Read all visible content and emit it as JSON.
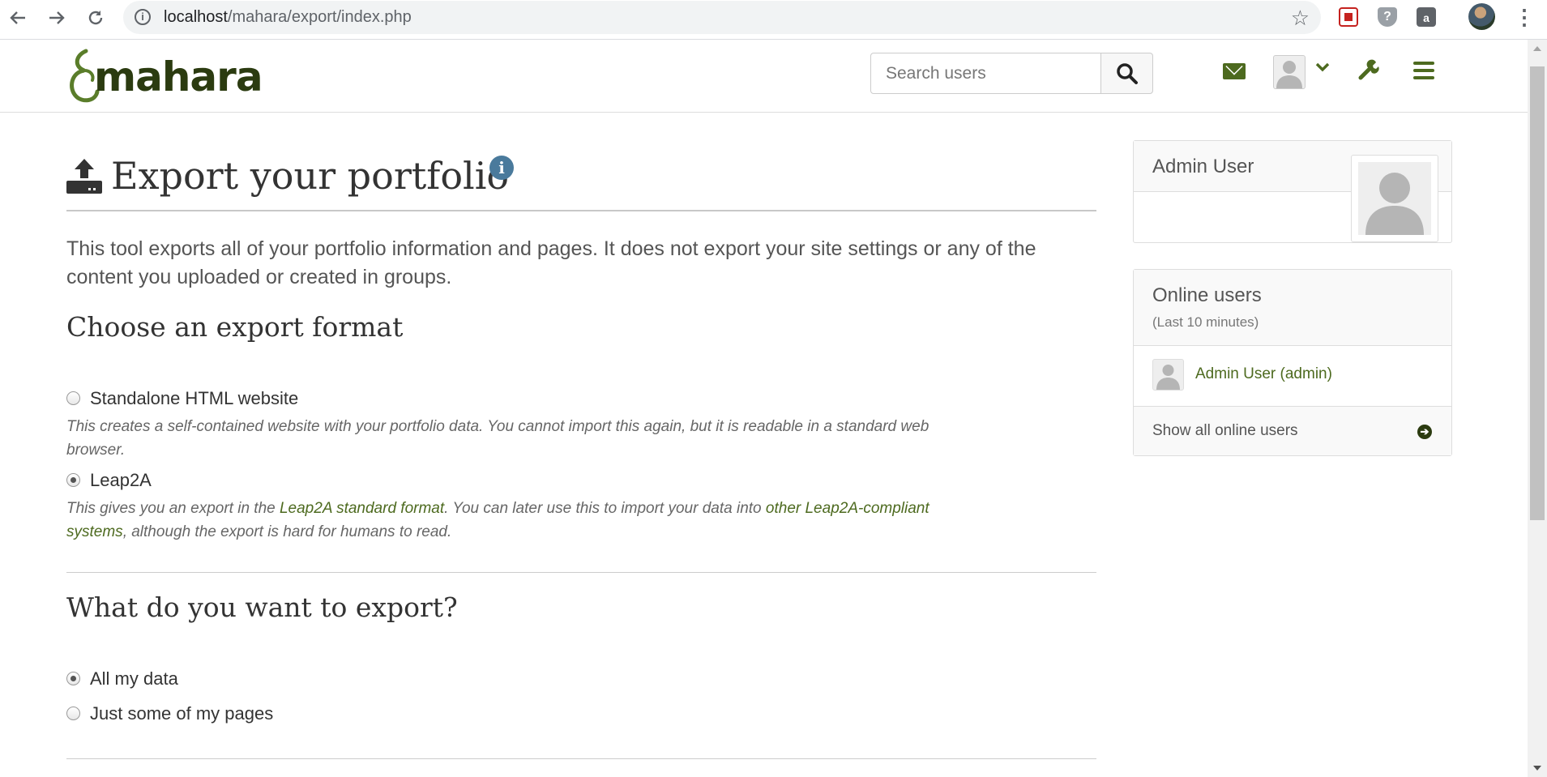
{
  "browser": {
    "url_host": "localhost",
    "url_path": "/mahara/export/index.php",
    "icons": [
      "back-icon",
      "forward-icon",
      "reload-icon",
      "site-info-icon",
      "bookmark-star-icon",
      "kebab-menu-icon"
    ]
  },
  "header": {
    "logo_text": "mahara",
    "search_placeholder": "Search users",
    "brand_color": "#4d6a1f",
    "dark_brand_color": "#2b3b10"
  },
  "main": {
    "title": "Export your portfolio",
    "intro": "This tool exports all of your portfolio information and pages. It does not export your site settings or any of the content you uploaded or created in groups.",
    "format_heading": "Choose an export format",
    "formats": [
      {
        "label": "Standalone HTML website",
        "checked": false,
        "description": "This creates a self-contained website with your portfolio data. You cannot import this again, but it is readable in a standard web browser."
      },
      {
        "label": "Leap2A",
        "checked": true,
        "description_pre": "This gives you an export in the ",
        "description_link1": "Leap2A standard format",
        "description_mid": ". You can later use this to import your data into ",
        "description_link2": "other Leap2A-compliant systems",
        "description_post": ", although the export is hard for humans to read."
      }
    ],
    "what_heading": "What do you want to export?",
    "what_options": [
      {
        "label": "All my data",
        "checked": true
      },
      {
        "label": "Just some of my pages",
        "checked": false
      }
    ]
  },
  "sidebar": {
    "profile_name": "Admin User",
    "online_title": "Online users",
    "online_subtitle": "(Last 10 minutes)",
    "online_users": [
      "Admin User (admin)"
    ],
    "show_all_label": "Show all online users"
  }
}
